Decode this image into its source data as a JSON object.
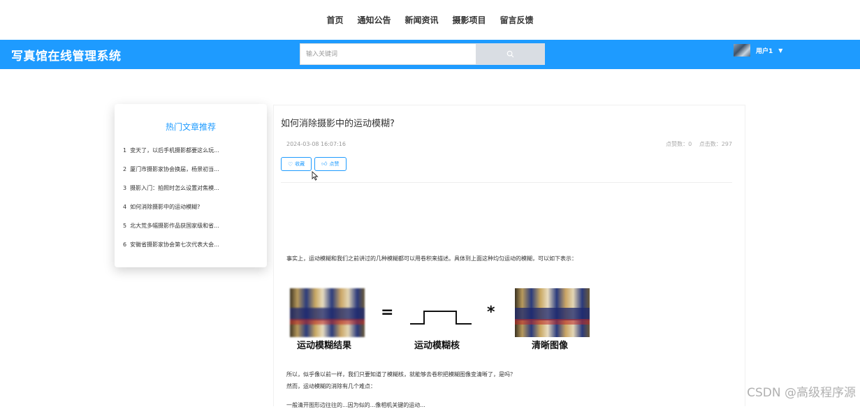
{
  "nav": {
    "items": [
      "首页",
      "通知公告",
      "新闻资讯",
      "摄影项目",
      "留言反馈"
    ]
  },
  "header": {
    "brand": "写真馆在线管理系统",
    "search_placeholder": "输入关键词",
    "username": "用户1"
  },
  "sidebar": {
    "title": "热门文章推荐",
    "items": [
      {
        "num": "1",
        "label": "变天了，以后手机摄影都要这么玩..."
      },
      {
        "num": "2",
        "label": "厦门市摄影家协会换届，杨景初当..."
      },
      {
        "num": "3",
        "label": "摄影入门：拍照时怎么设置对焦模..."
      },
      {
        "num": "4",
        "label": "如何消除摄影中的运动模糊?"
      },
      {
        "num": "5",
        "label": "北大荒多幅摄影作品获国家级和省..."
      },
      {
        "num": "6",
        "label": "安徽省摄影家协会第七次代表大会..."
      }
    ]
  },
  "article": {
    "title": "如何消除摄影中的运动模糊?",
    "date": "2024-03-08 16:07:16",
    "likes_label": "点赞数：0",
    "clicks_label": "点击数：297",
    "collect_label": "收藏",
    "like_label": "点赞",
    "para1": "事实上，运动模糊和我们之前讲过的几种模糊都可以用卷积来描述。具体到上面这种均匀运动的模糊，可以如下表示：",
    "figure": {
      "equals": "=",
      "times": "*",
      "caption_result": "运动模糊结果",
      "caption_kernel": "运动模糊核",
      "caption_clear": "清晰图像"
    },
    "para2": "所以，似乎像以前一样，我们只要知道了模糊核，就能够去卷积把模糊图像变清晰了，是吗？",
    "para2b": "然而，运动模糊的消除有几个难点：",
    "para3": "一般清开图形边往往的...因为似的...像相机关键的运动..."
  },
  "watermark": "CSDN @高级程序源",
  "colors": {
    "accent": "#1e9bff",
    "header_bg": "#1e9bff"
  },
  "icons": {
    "search": "search-icon",
    "collect": "heart-icon",
    "like": "thumbs-up-icon",
    "caret": "caret-down-icon"
  }
}
